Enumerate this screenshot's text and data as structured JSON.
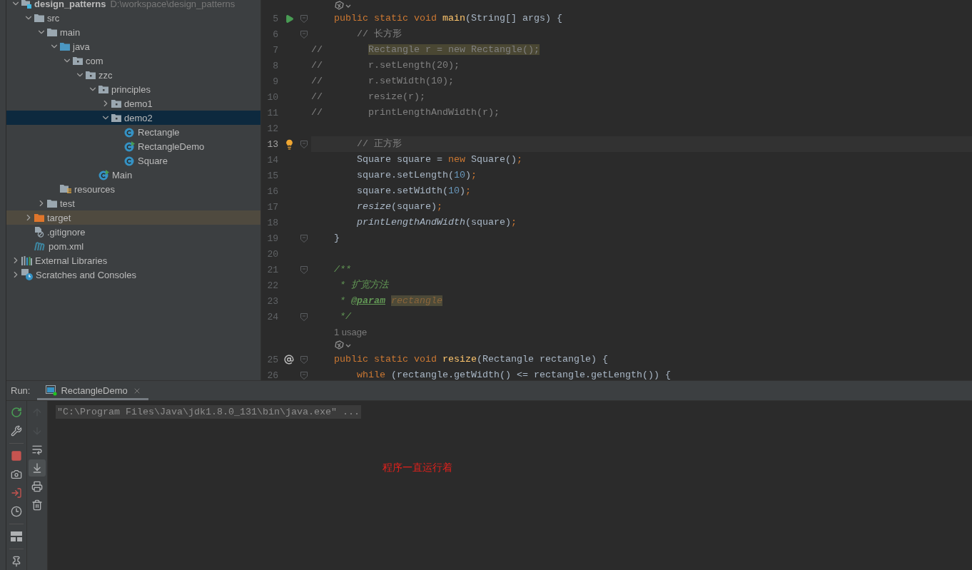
{
  "project": {
    "tree": [
      {
        "label": "design_patterns",
        "hint": "D:\\workspace\\design_patterns",
        "kind": "module",
        "bold": true,
        "expanded": true,
        "selected": false,
        "highlighted": false,
        "children": [
          {
            "label": "src",
            "kind": "folder",
            "expanded": true,
            "selected": false,
            "highlighted": false,
            "children": [
              {
                "label": "main",
                "kind": "folder",
                "expanded": true,
                "selected": false,
                "highlighted": false,
                "children": [
                  {
                    "label": "java",
                    "kind": "source-folder",
                    "expanded": true,
                    "selected": false,
                    "highlighted": false,
                    "children": [
                      {
                        "label": "com",
                        "kind": "package",
                        "expanded": true,
                        "selected": false,
                        "highlighted": false,
                        "children": [
                          {
                            "label": "zzc",
                            "kind": "package",
                            "expanded": true,
                            "selected": false,
                            "highlighted": false,
                            "children": [
                              {
                                "label": "principles",
                                "kind": "package",
                                "expanded": true,
                                "selected": false,
                                "highlighted": false,
                                "children": [
                                  {
                                    "label": "demo1",
                                    "kind": "package",
                                    "expanded": false,
                                    "selected": false,
                                    "highlighted": false
                                  },
                                  {
                                    "label": "demo2",
                                    "kind": "package",
                                    "expanded": true,
                                    "selected": true,
                                    "highlighted": false,
                                    "children": [
                                      {
                                        "label": "Rectangle",
                                        "kind": "class",
                                        "selected": false,
                                        "highlighted": false
                                      },
                                      {
                                        "label": "RectangleDemo",
                                        "kind": "main-class",
                                        "selected": false,
                                        "highlighted": false
                                      },
                                      {
                                        "label": "Square",
                                        "kind": "class",
                                        "selected": false,
                                        "highlighted": false
                                      }
                                    ]
                                  }
                                ]
                              },
                              {
                                "label": "Main",
                                "kind": "main-class",
                                "selected": false,
                                "highlighted": false
                              }
                            ]
                          }
                        ]
                      }
                    ]
                  },
                  {
                    "label": "resources",
                    "kind": "resources",
                    "selected": false,
                    "highlighted": false
                  }
                ]
              },
              {
                "label": "test",
                "kind": "folder",
                "expanded": false,
                "selected": false,
                "highlighted": false
              }
            ]
          },
          {
            "label": "target",
            "kind": "excluded-folder",
            "expanded": false,
            "selected": false,
            "highlighted": true
          },
          {
            "label": ".gitignore",
            "kind": "ignore-file",
            "selected": false,
            "highlighted": false
          },
          {
            "label": "pom.xml",
            "kind": "maven",
            "selected": false,
            "highlighted": false
          }
        ]
      },
      {
        "label": "External Libraries",
        "kind": "libraries",
        "expanded": false,
        "selected": false,
        "highlighted": false
      },
      {
        "label": "Scratches and Consoles",
        "kind": "scratches",
        "expanded": false,
        "selected": false,
        "highlighted": false
      }
    ]
  },
  "editor": {
    "rows": [
      {
        "kind": "vision"
      },
      {
        "kind": "code",
        "number": "5",
        "current": false,
        "run": true,
        "fold": true,
        "tokens": [
          {
            "text": "    public static void ",
            "kind": "keyword"
          },
          {
            "text": "main",
            "kind": "method"
          },
          {
            "text": "(String[] args) {",
            "kind": "plain"
          }
        ]
      },
      {
        "kind": "code",
        "number": "6",
        "current": false,
        "fold": true,
        "tokens": [
          {
            "text": "        // 长方形",
            "kind": "comment"
          }
        ]
      },
      {
        "kind": "code",
        "number": "7",
        "current": false,
        "tokens": [
          {
            "text": "//        ",
            "kind": "comment"
          },
          {
            "text": "Rectangle r = new Rectangle();",
            "kind": "highlight"
          }
        ]
      },
      {
        "kind": "code",
        "number": "8",
        "current": false,
        "tokens": [
          {
            "text": "//        r.setLength(20);",
            "kind": "comment"
          }
        ]
      },
      {
        "kind": "code",
        "number": "9",
        "current": false,
        "tokens": [
          {
            "text": "//        r.setWidth(10);",
            "kind": "comment"
          }
        ]
      },
      {
        "kind": "code",
        "number": "10",
        "current": false,
        "tokens": [
          {
            "text": "//        resize(r);",
            "kind": "comment"
          }
        ]
      },
      {
        "kind": "code",
        "number": "11",
        "current": false,
        "tokens": [
          {
            "text": "//        printLengthAndWidth(r);",
            "kind": "comment"
          }
        ]
      },
      {
        "kind": "code",
        "number": "12",
        "current": false,
        "tokens": []
      },
      {
        "kind": "code",
        "number": "13",
        "current": true,
        "fold": true,
        "bulb": true,
        "tokens": [
          {
            "text": "        // 正方形",
            "kind": "comment"
          }
        ]
      },
      {
        "kind": "code",
        "number": "14",
        "current": false,
        "tokens": [
          {
            "text": "        Square square = ",
            "kind": "plain"
          },
          {
            "text": "new",
            "kind": "keyword"
          },
          {
            "text": " Square()",
            "kind": "plain"
          },
          {
            "text": ";",
            "kind": "keyword"
          }
        ]
      },
      {
        "kind": "code",
        "number": "15",
        "current": false,
        "tokens": [
          {
            "text": "        square.setLength(",
            "kind": "plain"
          },
          {
            "text": "10",
            "kind": "number"
          },
          {
            "text": ")",
            "kind": "plain"
          },
          {
            "text": ";",
            "kind": "keyword"
          }
        ]
      },
      {
        "kind": "code",
        "number": "16",
        "current": false,
        "tokens": [
          {
            "text": "        square.setWidth(",
            "kind": "plain"
          },
          {
            "text": "10",
            "kind": "number"
          },
          {
            "text": ")",
            "kind": "plain"
          },
          {
            "text": ";",
            "kind": "keyword"
          }
        ]
      },
      {
        "kind": "code",
        "number": "17",
        "current": false,
        "tokens": [
          {
            "text": "        resize",
            "kind": "static"
          },
          {
            "text": "(square)",
            "kind": "plain"
          },
          {
            "text": ";",
            "kind": "keyword"
          }
        ]
      },
      {
        "kind": "code",
        "number": "18",
        "current": false,
        "tokens": [
          {
            "text": "        printLengthAndWidth",
            "kind": "static"
          },
          {
            "text": "(square)",
            "kind": "plain"
          },
          {
            "text": ";",
            "kind": "keyword"
          }
        ]
      },
      {
        "kind": "code",
        "number": "19",
        "current": false,
        "fold": true,
        "tokens": [
          {
            "text": "    }",
            "kind": "plain"
          }
        ]
      },
      {
        "kind": "code",
        "number": "20",
        "current": false,
        "tokens": []
      },
      {
        "kind": "code",
        "number": "21",
        "current": false,
        "fold": true,
        "tokens": [
          {
            "text": "    /**",
            "kind": "doc"
          }
        ]
      },
      {
        "kind": "code",
        "number": "22",
        "current": false,
        "tokens": [
          {
            "text": "     * ",
            "kind": "doc"
          },
          {
            "text": "扩宽方法",
            "kind": "doc-italic"
          }
        ]
      },
      {
        "kind": "code",
        "number": "23",
        "current": false,
        "tokens": [
          {
            "text": "     * ",
            "kind": "doc"
          },
          {
            "text": "@param",
            "kind": "doc-tag"
          },
          {
            "text": "rectangle",
            "kind": "doc-param"
          }
        ]
      },
      {
        "kind": "code",
        "number": "24",
        "current": false,
        "fold": true,
        "tokens": [
          {
            "text": "     */",
            "kind": "doc"
          }
        ]
      },
      {
        "kind": "usage",
        "text": "1 usage"
      },
      {
        "kind": "vision"
      },
      {
        "kind": "code",
        "number": "25",
        "current": false,
        "override": true,
        "fold": true,
        "tokens": [
          {
            "text": "    public static void ",
            "kind": "keyword"
          },
          {
            "text": "resize",
            "kind": "method"
          },
          {
            "text": "(Rectangle rectangle) {",
            "kind": "plain"
          }
        ]
      },
      {
        "kind": "code",
        "number": "26",
        "current": false,
        "fold": true,
        "tokens": [
          {
            "text": "        while",
            "kind": "keyword"
          },
          {
            "text": " (rectangle.getWidth() <= rectangle.getLength()) {",
            "kind": "plain"
          }
        ]
      }
    ]
  },
  "run_panel": {
    "label": "Run:",
    "tabs": [
      {
        "label": "RectangleDemo",
        "selected": true
      }
    ],
    "left_tools": [
      {
        "kind": "rerun",
        "disabled": false
      },
      {
        "kind": "settings",
        "disabled": false
      },
      {
        "kind": "separator"
      },
      {
        "kind": "stop",
        "disabled": false
      },
      {
        "kind": "camera",
        "disabled": false
      },
      {
        "kind": "exit",
        "disabled": false
      },
      {
        "kind": "timer",
        "disabled": false
      },
      {
        "kind": "separator"
      },
      {
        "kind": "layout",
        "disabled": false
      },
      {
        "kind": "separator"
      },
      {
        "kind": "pin",
        "disabled": false
      }
    ],
    "right_tools": [
      {
        "kind": "up",
        "disabled": true
      },
      {
        "kind": "down",
        "disabled": true
      },
      {
        "kind": "wrap",
        "disabled": false
      },
      {
        "kind": "scroll-end",
        "disabled": false,
        "on": true
      },
      {
        "kind": "print",
        "disabled": false
      },
      {
        "kind": "trash",
        "disabled": false
      }
    ],
    "console": [
      {
        "text": "\"C:\\Program Files\\Java\\jdk1.8.0_131\\bin\\java.exe\" ...",
        "highlighted": true
      }
    ],
    "annotation": "程序一直运行着"
  }
}
